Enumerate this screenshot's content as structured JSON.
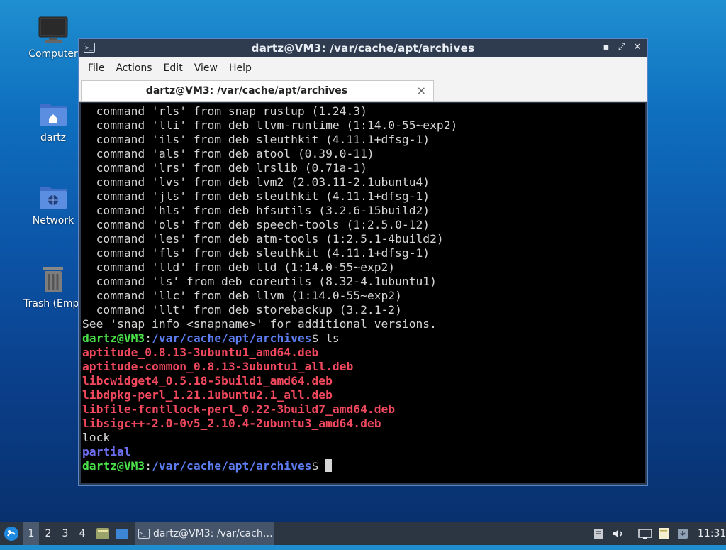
{
  "desktop": {
    "icons": [
      {
        "label": "Computer",
        "icon": "monitor-icon"
      },
      {
        "label": "dartz",
        "icon": "home-folder-icon"
      },
      {
        "label": "Network",
        "icon": "network-folder-icon"
      },
      {
        "label": "Trash (Empt",
        "icon": "trash-icon"
      }
    ]
  },
  "window": {
    "title": "dartz@VM3: /var/cache/apt/archives",
    "menu": [
      "File",
      "Actions",
      "Edit",
      "View",
      "Help"
    ],
    "tab_label": "dartz@VM3: /var/cache/apt/archives",
    "tab_close": "×"
  },
  "terminal": {
    "command_lines": [
      "  command 'rls' from snap rustup (1.24.3)",
      "  command 'lli' from deb llvm-runtime (1:14.0-55~exp2)",
      "  command 'ils' from deb sleuthkit (4.11.1+dfsg-1)",
      "  command 'als' from deb atool (0.39.0-11)",
      "  command 'lrs' from deb lrslib (0.71a-1)",
      "  command 'lvs' from deb lvm2 (2.03.11-2.1ubuntu4)",
      "  command 'jls' from deb sleuthkit (4.11.1+dfsg-1)",
      "  command 'hls' from deb hfsutils (3.2.6-15build2)",
      "  command 'ols' from deb speech-tools (1:2.5.0-12)",
      "  command 'les' from deb atm-tools (1:2.5.1-4build2)",
      "  command 'fls' from deb sleuthkit (4.11.1+dfsg-1)",
      "  command 'lld' from deb lld (1:14.0-55~exp2)",
      "  command 'ls' from deb coreutils (8.32-4.1ubuntu1)",
      "  command 'llc' from deb llvm (1:14.0-55~exp2)",
      "  command 'llt' from deb storebackup (3.2.1-2)"
    ],
    "snap_hint": "See 'snap info <snapname>' for additional versions.",
    "prompt_user": "dartz@VM3",
    "prompt_sep": ":",
    "prompt_path": "/var/cache/apt/archives",
    "prompt_end": "$ ",
    "command": "ls",
    "deb_files": [
      "aptitude_0.8.13-3ubuntu1_amd64.deb",
      "aptitude-common_0.8.13-3ubuntu1_all.deb",
      "libcwidget4_0.5.18-5build1_amd64.deb",
      "libdpkg-perl_1.21.1ubuntu2.1_all.deb",
      "libfile-fcntllock-perl_0.22-3build7_amd64.deb",
      "libsigc++-2.0-0v5_2.10.4-2ubuntu3_amd64.deb"
    ],
    "plain_entry": "lock",
    "dir_entry": "partial"
  },
  "taskbar": {
    "workspaces": [
      "1",
      "2",
      "3",
      "4"
    ],
    "active_workspace": "1",
    "task_label": "dartz@VM3: /var/cach…",
    "clock": "11:31"
  },
  "colors": {
    "prompt_user": "#4ae04a",
    "prompt_path": "#5c7cf0",
    "deb_file": "#f0485c",
    "directory": "#6e6ef0"
  }
}
